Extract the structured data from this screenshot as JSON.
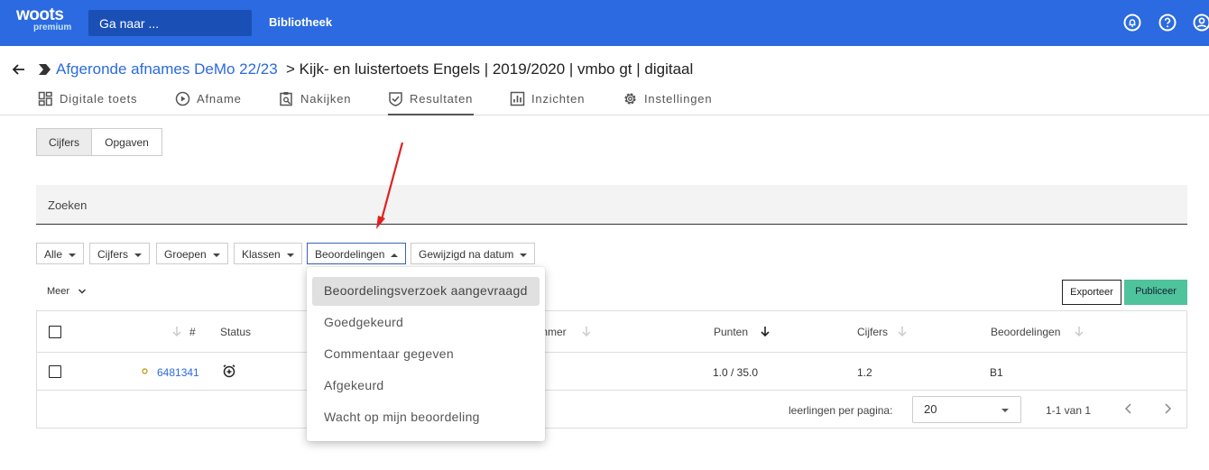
{
  "topbar": {
    "logo_main": "woots",
    "logo_sub": "premium",
    "search_placeholder": "Ga naar ...",
    "library_link": "Bibliotheek",
    "icons": [
      "notification-icon",
      "help-icon",
      "account-icon"
    ]
  },
  "breadcrumb": {
    "link": "Afgeronde afnames DeMo 22/23",
    "rest": "> Kijk- en luistertoets Engels | 2019/2020 | vmbo gt | digitaal"
  },
  "tabs": [
    {
      "label": "Digitale toets",
      "icon": "dashboard-icon"
    },
    {
      "label": "Afname",
      "icon": "play-circle-icon"
    },
    {
      "label": "Nakijken",
      "icon": "clipboard-search-icon"
    },
    {
      "label": "Resultaten",
      "icon": "check-shield-icon",
      "active": true
    },
    {
      "label": "Inzichten",
      "icon": "bar-chart-icon"
    },
    {
      "label": "Instellingen",
      "icon": "gear-icon"
    }
  ],
  "segments": {
    "grades": "Cijfers",
    "questions": "Opgaven"
  },
  "search": {
    "placeholder": "Zoeken"
  },
  "filters": {
    "all": "Alle",
    "grades": "Cijfers",
    "groups": "Groepen",
    "classes": "Klassen",
    "reviews": "Beoordelingen",
    "modified": "Gewijzigd na datum"
  },
  "more": "Meer",
  "actions": {
    "export": "Exporteer",
    "publish": "Publiceer"
  },
  "table": {
    "headers": {
      "number": "#",
      "status": "Status",
      "student_number_partial": "mmer",
      "points": "Punten",
      "grades": "Cijfers",
      "reviews": "Beoordelingen"
    },
    "rows": [
      {
        "id": "6481341",
        "points": "1.0 / 35.0",
        "grade": "1.2",
        "review": "B1"
      }
    ]
  },
  "pagination": {
    "per_page_label": "leerlingen per pagina:",
    "per_page_value": "20",
    "range": "1-1 van 1"
  },
  "dropdown": {
    "items": [
      "Beoordelingsverzoek aangevraagd",
      "Goedgekeurd",
      "Commentaar gegeven",
      "Afgekeurd",
      "Wacht op mijn beoordeling"
    ]
  },
  "colors": {
    "brand": "#2b6ae0",
    "publish": "#4fc39b",
    "annotation_arrow": "#e02020"
  }
}
